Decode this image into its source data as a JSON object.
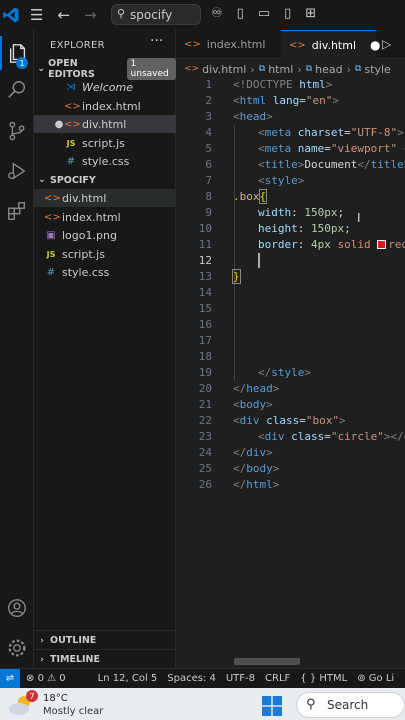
{
  "titlebar": {
    "search_text": "spocify"
  },
  "explorer": {
    "title": "EXPLORER",
    "open_editors": {
      "label": "OPEN EDITORS",
      "badge": "1 unsaved",
      "items": [
        {
          "label": "Welcome",
          "icon": "vscode-icon"
        },
        {
          "label": "index.html",
          "icon": "html-icon"
        },
        {
          "label": "div.html",
          "icon": "html-icon",
          "modified": "●"
        },
        {
          "label": "script.js",
          "icon": "js-icon"
        },
        {
          "label": "style.css",
          "icon": "css-icon"
        }
      ]
    },
    "folder": {
      "label": "SPOCIFY",
      "items": [
        {
          "label": "div.html",
          "icon": "html-icon"
        },
        {
          "label": "index.html",
          "icon": "html-icon"
        },
        {
          "label": "logo1.png",
          "icon": "image-icon"
        },
        {
          "label": "script.js",
          "icon": "js-icon"
        },
        {
          "label": "style.css",
          "icon": "css-icon"
        }
      ]
    },
    "outline": "OUTLINE",
    "timeline": "TIMELINE",
    "activity_badge": "1"
  },
  "tabs": [
    {
      "label": "index.html"
    },
    {
      "label": "div.html",
      "dirty": "●"
    }
  ],
  "breadcrumbs": [
    "div.html",
    "html",
    "head",
    "style"
  ],
  "code": {
    "lines": [
      {
        "n": "1"
      },
      {
        "n": "2"
      },
      {
        "n": "3"
      },
      {
        "n": "4"
      },
      {
        "n": "5"
      },
      {
        "n": "6"
      },
      {
        "n": "7"
      },
      {
        "n": "8"
      },
      {
        "n": "9"
      },
      {
        "n": "10"
      },
      {
        "n": "11"
      },
      {
        "n": "12"
      },
      {
        "n": "13"
      },
      {
        "n": "14"
      },
      {
        "n": "15"
      },
      {
        "n": "16"
      },
      {
        "n": "17"
      },
      {
        "n": "18"
      },
      {
        "n": "19"
      },
      {
        "n": "20"
      },
      {
        "n": "21"
      },
      {
        "n": "22"
      },
      {
        "n": "23"
      },
      {
        "n": "24"
      },
      {
        "n": "25"
      },
      {
        "n": "26"
      }
    ],
    "l1_doctype": "<!DOCTYPE",
    "l1_html": "html",
    "l1_close": ">",
    "l2_open": "<",
    "l2_tag": "html",
    "l2_attr": "lang",
    "l2_eq": "=",
    "l2_val": "\"en\"",
    "l2_close": ">",
    "l3": "head",
    "l4_tag": "meta",
    "l4_attr": "charset",
    "l4_val": "\"UTF-8\"",
    "l4_end": " ",
    "l5_tag": "meta",
    "l5_attr": "name",
    "l5_val": "\"viewport\"",
    "l5_end": " c",
    "l6_tag": "title",
    "l6_text": "Document",
    "l6_ctag": "title",
    "l7_tag": "style",
    "l8_sel": ".box",
    "l8_brace": "{",
    "l9_prop": "width",
    "l9_val": "150px",
    "l10_prop": "height",
    "l10_val": "150px",
    "l11_prop": "border",
    "l11_num": "4px",
    "l11_kw": "solid",
    "l11_color": "red",
    "l13_brace": "}",
    "l19_tag": "style",
    "l20_tag": "head",
    "l21_tag": "body",
    "l22_tag": "div",
    "l22_attr": "class",
    "l22_val": "\"box\"",
    "l23_tag": "div",
    "l23_attr": "class",
    "l23_val": "\"circle\"",
    "l23_end": "></d",
    "l24_tag": "div",
    "l25_tag": "body",
    "l26_tag": "html"
  },
  "status": {
    "errors": "0",
    "warnings": "0",
    "position": "Ln 12, Col 5",
    "spaces": "Spaces: 4",
    "encoding": "UTF-8",
    "eol": "CRLF",
    "language": "HTML",
    "golive": "Go Li"
  },
  "taskbar": {
    "temp": "18°C",
    "desc": "Mostly clear",
    "weather_badge": "7",
    "search": "Search"
  },
  "colors": {
    "accent": "#0078d4",
    "editor_bg": "#1f1f1f",
    "sidebar_bg": "#181818"
  }
}
